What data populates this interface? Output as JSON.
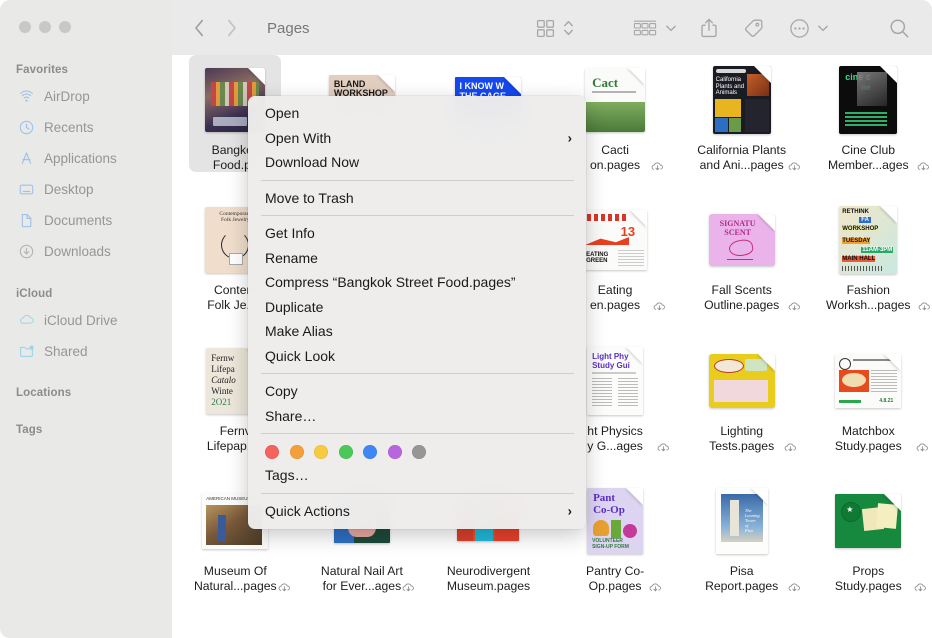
{
  "window": {
    "title": "Pages",
    "traffic_lights": [
      "close",
      "minimize",
      "zoom"
    ]
  },
  "sidebar": {
    "sections": [
      {
        "header": "Favorites",
        "items": [
          {
            "label": "AirDrop",
            "icon": "airdrop-icon"
          },
          {
            "label": "Recents",
            "icon": "clock-icon"
          },
          {
            "label": "Applications",
            "icon": "applications-icon"
          },
          {
            "label": "Desktop",
            "icon": "desktop-icon"
          },
          {
            "label": "Documents",
            "icon": "document-icon"
          },
          {
            "label": "Downloads",
            "icon": "downloads-icon"
          }
        ]
      },
      {
        "header": "iCloud",
        "items": [
          {
            "label": "iCloud Drive",
            "icon": "cloud-icon"
          },
          {
            "label": "Shared",
            "icon": "shared-folder-icon"
          }
        ]
      },
      {
        "header": "Locations",
        "items": []
      },
      {
        "header": "Tags",
        "items": []
      }
    ]
  },
  "toolbar": {
    "back_label": "Back",
    "forward_label": "Forward",
    "title": "Pages",
    "buttons": [
      {
        "name": "view-as-icons",
        "icon": "grid-view-icon"
      },
      {
        "name": "view-stepper",
        "icon": "chevron-up-down-icon"
      },
      {
        "name": "group-by",
        "icon": "group-list-icon"
      },
      {
        "name": "group-by-chevron",
        "icon": "chevron-down-icon"
      },
      {
        "name": "share",
        "icon": "share-icon"
      },
      {
        "name": "add-tag",
        "icon": "tag-icon"
      },
      {
        "name": "more-actions",
        "icon": "ellipsis-circle-icon"
      },
      {
        "name": "more-chevron",
        "icon": "chevron-down-icon"
      },
      {
        "name": "search",
        "icon": "search-icon"
      }
    ]
  },
  "context_menu": {
    "groups": [
      {
        "items": [
          {
            "label": "Open",
            "submenu": false
          },
          {
            "label": "Open With",
            "submenu": true
          },
          {
            "label": "Download Now",
            "submenu": false
          }
        ]
      },
      {
        "items": [
          {
            "label": "Move to Trash",
            "submenu": false
          }
        ]
      },
      {
        "items": [
          {
            "label": "Get Info",
            "submenu": false
          },
          {
            "label": "Rename",
            "submenu": false
          },
          {
            "label": "Compress “Bangkok Street Food.pages”",
            "submenu": false
          },
          {
            "label": "Duplicate",
            "submenu": false
          },
          {
            "label": "Make Alias",
            "submenu": false
          },
          {
            "label": "Quick Look",
            "submenu": false
          }
        ]
      },
      {
        "items": [
          {
            "label": "Copy",
            "submenu": false
          },
          {
            "label": "Share…",
            "submenu": false
          }
        ]
      },
      {
        "tag_colors": [
          {
            "name": "red",
            "hex": "#f4645c"
          },
          {
            "name": "orange",
            "hex": "#f4a03a"
          },
          {
            "name": "yellow",
            "hex": "#f6cb42"
          },
          {
            "name": "green",
            "hex": "#4cc85a"
          },
          {
            "name": "blue",
            "hex": "#3f87f5"
          },
          {
            "name": "purple",
            "hex": "#b濃"
          },
          {
            "name": "gray",
            "hex": "#969696"
          }
        ],
        "items": [
          {
            "label": "Tags…",
            "submenu": false
          }
        ]
      },
      {
        "items": [
          {
            "label": "Quick Actions",
            "submenu": true
          }
        ]
      }
    ],
    "tag_colors": [
      {
        "name": "red",
        "hex": "#f4645c"
      },
      {
        "name": "orange",
        "hex": "#f4a03a"
      },
      {
        "name": "yellow",
        "hex": "#f6cb42"
      },
      {
        "name": "green",
        "hex": "#4cc85a"
      },
      {
        "name": "blue",
        "hex": "#3f87f5"
      },
      {
        "name": "purple",
        "hex": "#b濃"
      },
      {
        "name": "gray",
        "hex": "#969696"
      }
    ]
  },
  "files": {
    "rows": [
      [
        {
          "name": "Bangkok\nFood.pa",
          "full": "Bangkok Street Food.pages",
          "cloud": false,
          "selected": true,
          "thumb": "bangkok"
        },
        {
          "name": "",
          "full": "Bland Workshop.pages",
          "cloud": false,
          "selected": false,
          "thumb": "bland"
        },
        {
          "name": "",
          "full": "I Know What The Cage.pages",
          "cloud": false,
          "selected": false,
          "thumb": "cage"
        },
        {
          "name": "Cacti\non.pages",
          "full": "Cacti Collection.pages",
          "cloud": true,
          "selected": false,
          "thumb": "cacti"
        },
        {
          "name": "California Plants\nand Ani...pages",
          "full": "California Plants and Animals.pages",
          "cloud": true,
          "selected": false,
          "thumb": "calplants"
        },
        {
          "name": "Cine Club\nMember...ages",
          "full": "Cine Club Membership.pages",
          "cloud": true,
          "selected": false,
          "thumb": "cineclub"
        }
      ],
      [
        {
          "name": "Contem\nFolk Je...p",
          "full": "Contemporary Folk Jewelry.pages",
          "cloud": false,
          "selected": false,
          "thumb": "folk"
        },
        {
          "name": "",
          "full": "",
          "cloud": false,
          "selected": false,
          "thumb": "blank"
        },
        {
          "name": "",
          "full": "",
          "cloud": false,
          "selected": false,
          "thumb": "blank"
        },
        {
          "name": "Eating\nen.pages",
          "full": "Eating Green.pages",
          "cloud": true,
          "selected": false,
          "thumb": "eating"
        },
        {
          "name": "Fall Scents\nOutline.pages",
          "full": "Fall Scents Outline.pages",
          "cloud": true,
          "selected": false,
          "thumb": "fallscents"
        },
        {
          "name": "Fashion\nWorksh...pages",
          "full": "Fashion Workshop.pages",
          "cloud": true,
          "selected": false,
          "thumb": "fashion"
        }
      ],
      [
        {
          "name": "Fernv\nLifepap...p",
          "full": "Fernway Lifepaper Catalog.pages",
          "cloud": false,
          "selected": false,
          "thumb": "fernway"
        },
        {
          "name": "",
          "full": "",
          "cloud": false,
          "selected": false,
          "thumb": "blank"
        },
        {
          "name": "",
          "full": "",
          "cloud": false,
          "selected": false,
          "thumb": "blank"
        },
        {
          "name": "ht Physics\ny G...ages",
          "full": "Light Physics Study Guide.pages",
          "cloud": true,
          "selected": false,
          "thumb": "lightphys"
        },
        {
          "name": "Lighting\nTests.pages",
          "full": "Lighting Tests.pages",
          "cloud": true,
          "selected": false,
          "thumb": "lighting"
        },
        {
          "name": "Matchbox\nStudy.pages",
          "full": "Matchbox Study.pages",
          "cloud": true,
          "selected": false,
          "thumb": "matchbox"
        }
      ],
      [
        {
          "name": "Museum Of\nNatural...pages",
          "full": "Museum Of Natural History.pages",
          "cloud": true,
          "selected": false,
          "thumb": "museum"
        },
        {
          "name": "Natural Nail Art\nfor Ever...ages",
          "full": "Natural Nail Art for Everyone.pages",
          "cloud": true,
          "selected": false,
          "thumb": "nailart"
        },
        {
          "name": "Neurodivergent\nMuseum.pages",
          "full": "Neurodivergent Museum.pages",
          "cloud": false,
          "selected": false,
          "thumb": "neuro"
        },
        {
          "name": "Pantry Co-\nOp.pages",
          "full": "Pantry Co-Op.pages",
          "cloud": true,
          "selected": false,
          "thumb": "pantry"
        },
        {
          "name": "Pisa\nReport.pages",
          "full": "Pisa Report.pages",
          "cloud": true,
          "selected": false,
          "thumb": "pisa"
        },
        {
          "name": "Props\nStudy.pages",
          "full": "Props Study.pages",
          "cloud": true,
          "selected": false,
          "thumb": "props"
        }
      ]
    ]
  },
  "colors": {
    "sidebar_bg": "#e9e9e7",
    "toolbar_bg": "#eaeaea",
    "content_bg": "#ffffff",
    "menu_bg": "#edecea",
    "sidebar_icon": "#a8c7e8",
    "selection_bg": "#e4e4e4"
  }
}
